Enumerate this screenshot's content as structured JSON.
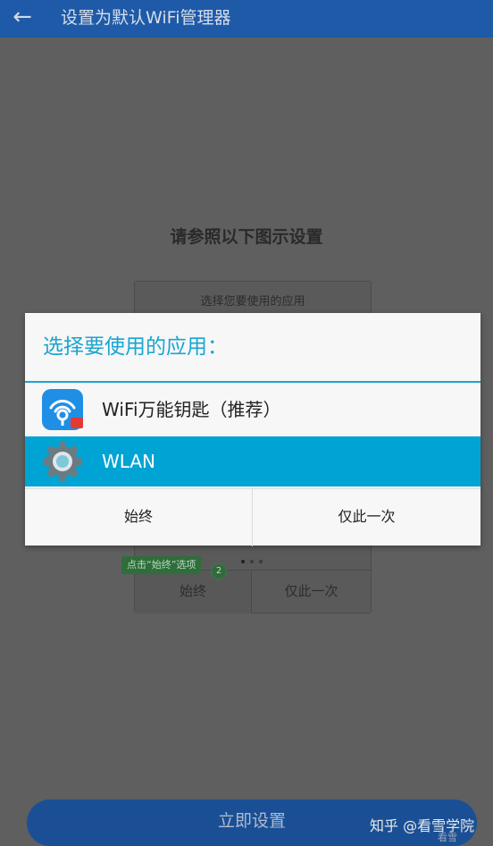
{
  "appbar": {
    "back_icon": "arrow-left-icon",
    "title": "设置为默认WiFi管理器"
  },
  "guide": {
    "heading": "请参照以下图示设置",
    "mock_header": "选择您要使用的应用",
    "mock_always": "始终",
    "mock_once": "仅此一次",
    "callout_text": "点击“始终”选项",
    "callout_step": "2"
  },
  "dialog": {
    "title": "选择要使用的应用：",
    "apps": [
      {
        "label": "WiFi万能钥匙（推荐）",
        "icon": "wifi-key-app-icon",
        "selected": false
      },
      {
        "label": "WLAN",
        "icon": "settings-gear-icon",
        "selected": true
      }
    ],
    "always_label": "始终",
    "once_label": "仅此一次"
  },
  "cta": {
    "label": "立即设置"
  },
  "watermark": {
    "text": "知乎 @看雪学院",
    "sub": "看雪"
  },
  "colors": {
    "accent": "#18a5d2",
    "selected_row": "#00a4d4",
    "appbar": "#1e5aa8"
  }
}
